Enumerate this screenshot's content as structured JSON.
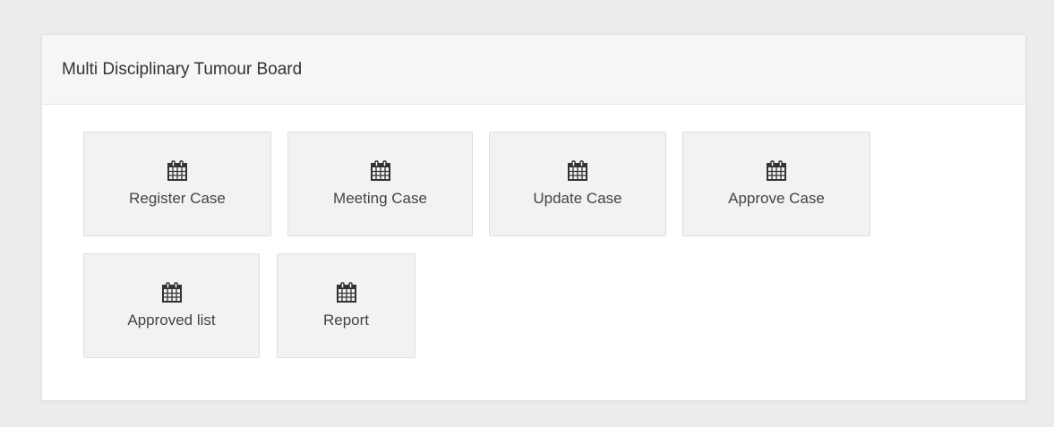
{
  "panel": {
    "title": "Multi Disciplinary Tumour Board"
  },
  "tiles": [
    {
      "label": "Register Case",
      "icon": "calendar-icon"
    },
    {
      "label": "Meeting Case",
      "icon": "calendar-icon"
    },
    {
      "label": "Update Case",
      "icon": "calendar-icon"
    },
    {
      "label": "Approve Case",
      "icon": "calendar-icon"
    },
    {
      "label": "Approved list",
      "icon": "calendar-icon"
    },
    {
      "label": "Report",
      "icon": "calendar-icon"
    }
  ],
  "colors": {
    "page_background": "#ececee",
    "panel_background": "#ffffff",
    "heading_background": "#f6f6f7",
    "tile_background": "#f2f2f3",
    "icon_color": "#333333"
  }
}
